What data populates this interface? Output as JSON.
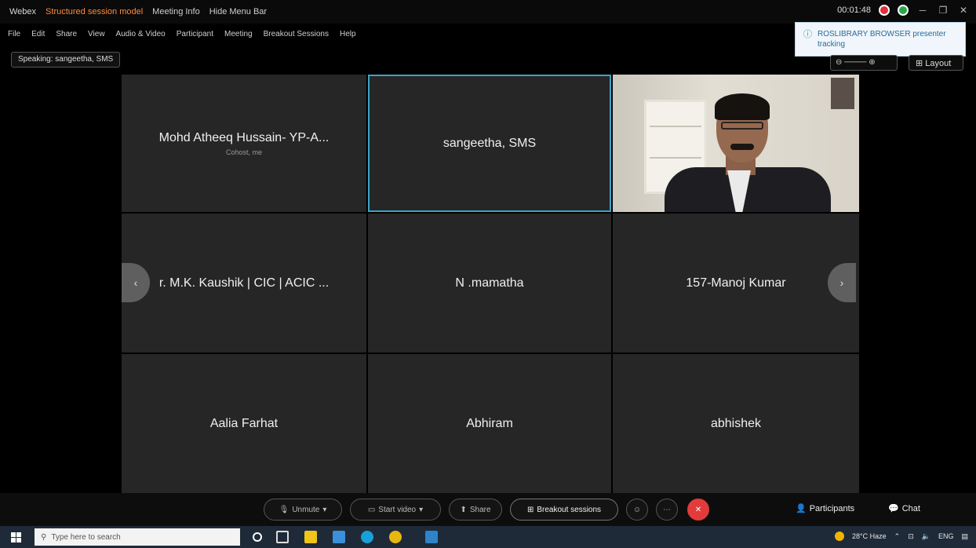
{
  "titlebar": {
    "app_name": "Webex",
    "recording_title": "Structured session model",
    "meeting_info": "Meeting Info",
    "hide_menu": "Hide Menu Bar",
    "timer": "00:01:48"
  },
  "menu": [
    "File",
    "Edit",
    "Share",
    "View",
    "Audio & Video",
    "Participant",
    "Meeting",
    "Breakout Sessions",
    "Help"
  ],
  "speaking_label": "Speaking: sangeetha, SMS",
  "toast": {
    "text": "ROSLIBRARY BROWSER presenter tracking"
  },
  "top_controls": {
    "layout_label": "Layout"
  },
  "tiles": [
    {
      "name": "Mohd Atheeq Hussain- YP-A...",
      "sub": "Cohost, me"
    },
    {
      "name": "sangeetha, SMS",
      "sub": ""
    },
    {
      "name": "",
      "sub": ""
    },
    {
      "name": "r. M.K. Kaushik | CIC | ACIC ...",
      "sub": ""
    },
    {
      "name": "N .mamatha",
      "sub": ""
    },
    {
      "name": "157-Manoj Kumar",
      "sub": ""
    },
    {
      "name": "Aalia Farhat",
      "sub": ""
    },
    {
      "name": "Abhiram",
      "sub": ""
    },
    {
      "name": "abhishek",
      "sub": ""
    }
  ],
  "controls": {
    "unmute": "Unmute",
    "start_video": "Start video",
    "share": "Share",
    "breakout": "Breakout sessions",
    "participants": "Participants",
    "chat": "Chat"
  },
  "taskbar": {
    "search_placeholder": "Type here to search",
    "weather": "28°C Haze",
    "lang": "ENG"
  },
  "colors": {
    "active_border": "#3ba4c8",
    "end_button": "#e23b3b",
    "tile_bg": "#262626"
  }
}
